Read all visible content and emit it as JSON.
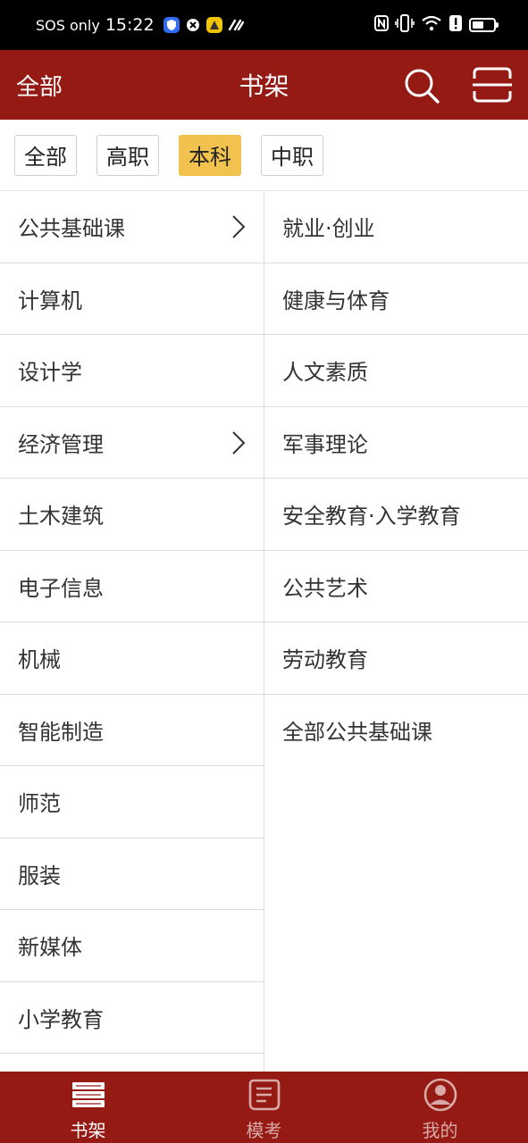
{
  "status_bar": {
    "carrier": "SOS only",
    "time": "15:22",
    "icons": [
      "shield-app-icon",
      "close-app-icon",
      "yellow-app-icon",
      "link-app-icon",
      "nfc-icon",
      "vibrate-icon",
      "wifi-icon",
      "alert-icon",
      "battery-icon"
    ],
    "battery_level": 0.55
  },
  "header": {
    "left_label": "全部",
    "title": "书架",
    "right_icons": [
      "search-icon",
      "scan-icon"
    ]
  },
  "filters": [
    {
      "label": "全部",
      "active": false
    },
    {
      "label": "高职",
      "active": false
    },
    {
      "label": "本科",
      "active": true
    },
    {
      "label": "中职",
      "active": false
    }
  ],
  "left_categories": [
    {
      "label": "公共基础课",
      "has_children": true
    },
    {
      "label": "计算机",
      "has_children": false
    },
    {
      "label": "设计学",
      "has_children": false
    },
    {
      "label": "经济管理",
      "has_children": true
    },
    {
      "label": "土木建筑",
      "has_children": false
    },
    {
      "label": "电子信息",
      "has_children": false
    },
    {
      "label": "机械",
      "has_children": false
    },
    {
      "label": "智能制造",
      "has_children": false
    },
    {
      "label": "师范",
      "has_children": false
    },
    {
      "label": "服装",
      "has_children": false
    },
    {
      "label": "新媒体",
      "has_children": false
    },
    {
      "label": "小学教育",
      "has_children": false
    }
  ],
  "right_categories": [
    "就业·创业",
    "健康与体育",
    "人文素质",
    "军事理论",
    "安全教育·入学教育",
    "公共艺术",
    "劳动教育",
    "全部公共基础课"
  ],
  "bottom_nav": [
    {
      "label": "书架",
      "icon": "bookshelf-icon",
      "active": true
    },
    {
      "label": "模考",
      "icon": "exam-icon",
      "active": false
    },
    {
      "label": "我的",
      "icon": "profile-icon",
      "active": false
    }
  ],
  "colors": {
    "brand": "#961a14",
    "active_chip": "#f2c24f"
  }
}
